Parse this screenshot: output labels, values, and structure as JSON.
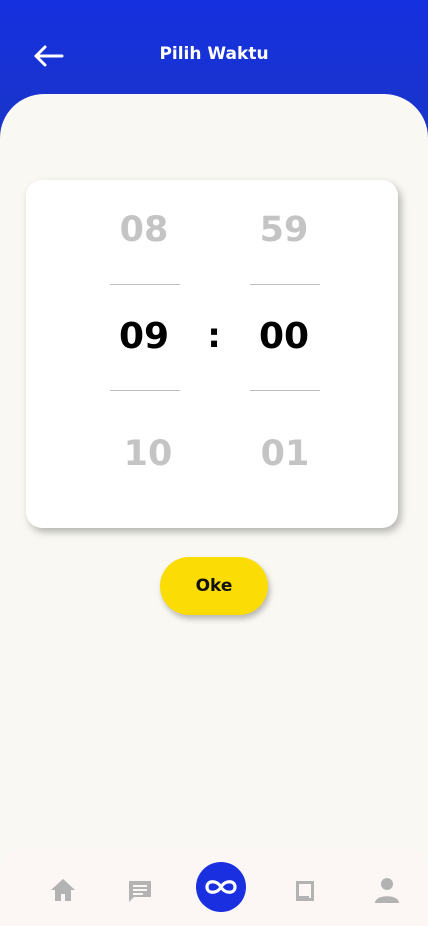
{
  "header": {
    "title": "Pilih Waktu",
    "back_icon": "arrow-left-icon",
    "color": "#1530df"
  },
  "picker": {
    "hours": {
      "prev": "08",
      "selected": "09",
      "next": "10"
    },
    "separator": ":",
    "minutes": {
      "prev": "59",
      "selected": "00",
      "next": "01"
    }
  },
  "confirm": {
    "label": "Oke",
    "color": "#fbdc04"
  },
  "bottom_nav": {
    "items": [
      {
        "icon": "home-icon"
      },
      {
        "icon": "chat-icon"
      },
      {
        "icon": "infinity-icon",
        "active": true
      },
      {
        "icon": "book-icon"
      },
      {
        "icon": "profile-icon"
      }
    ],
    "active_color": "#1a2fe0",
    "inactive_color": "#b3b3b3"
  }
}
